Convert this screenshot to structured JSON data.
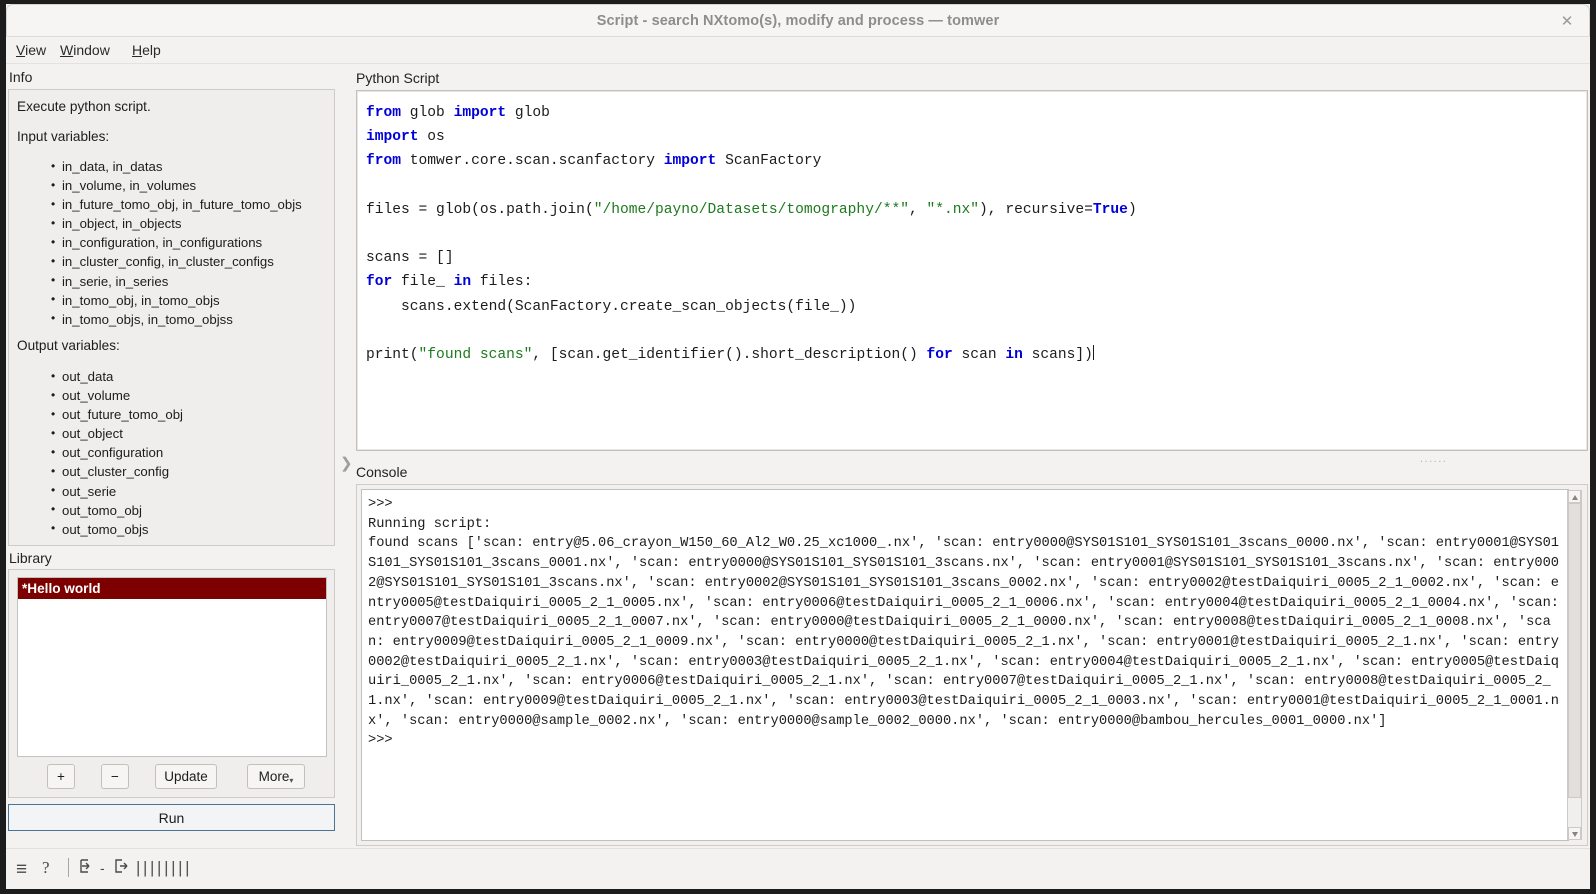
{
  "window": {
    "title": "Script - search NXtomo(s), modify and  process — tomwer",
    "close_label": "✕"
  },
  "menubar": {
    "items": [
      {
        "label": "View",
        "mnemonic": "V"
      },
      {
        "label": "Window",
        "mnemonic": "W"
      },
      {
        "label": "Help",
        "mnemonic": "H"
      }
    ]
  },
  "info": {
    "label": "Info",
    "description": "Execute python script.",
    "input_heading": "Input variables:",
    "input_variables": [
      "in_data, in_datas",
      "in_volume, in_volumes",
      "in_future_tomo_obj, in_future_tomo_objs",
      "in_object, in_objects",
      "in_configuration, in_configurations",
      "in_cluster_config, in_cluster_configs",
      "in_serie, in_series",
      "in_tomo_obj, in_tomo_objs",
      "in_tomo_objs, in_tomo_objss"
    ],
    "output_heading": "Output variables:",
    "output_variables": [
      "out_data",
      "out_volume",
      "out_future_tomo_obj",
      "out_object",
      "out_configuration",
      "out_cluster_config",
      "out_serie",
      "out_tomo_obj",
      "out_tomo_objs"
    ]
  },
  "library": {
    "label": "Library",
    "items": [
      {
        "label": "*Hello world",
        "selected": true
      }
    ],
    "selected_color": "#7c0000",
    "buttons": {
      "add": "+",
      "remove": "−",
      "update": "Update",
      "more": "More",
      "more_caret": "▾"
    },
    "run_label": "Run",
    "run_border_color": "#4b7394"
  },
  "script": {
    "label": "Python Script",
    "lines": [
      [
        {
          "t": "from",
          "c": "kw"
        },
        {
          "t": " glob ",
          "c": ""
        },
        {
          "t": "import",
          "c": "kw"
        },
        {
          "t": " glob",
          "c": ""
        }
      ],
      [
        {
          "t": "import",
          "c": "kw"
        },
        {
          "t": " os",
          "c": ""
        }
      ],
      [
        {
          "t": "from",
          "c": "kw"
        },
        {
          "t": " tomwer.core.scan.scanfactory ",
          "c": ""
        },
        {
          "t": "import",
          "c": "kw"
        },
        {
          "t": " ScanFactory",
          "c": ""
        }
      ],
      [],
      [
        {
          "t": "files = glob(os.path.join(",
          "c": ""
        },
        {
          "t": "\"/home/payno/Datasets/tomography/**\"",
          "c": "str"
        },
        {
          "t": ", ",
          "c": ""
        },
        {
          "t": "\"*.nx\"",
          "c": "str"
        },
        {
          "t": "), recursive=",
          "c": ""
        },
        {
          "t": "True",
          "c": "kw"
        },
        {
          "t": ")",
          "c": ""
        }
      ],
      [],
      [
        {
          "t": "scans = []",
          "c": ""
        }
      ],
      [
        {
          "t": "for",
          "c": "kw"
        },
        {
          "t": " file_ ",
          "c": ""
        },
        {
          "t": "in",
          "c": "kw"
        },
        {
          "t": " files:",
          "c": ""
        }
      ],
      [
        {
          "t": "    scans.extend(ScanFactory.create_scan_objects(file_))",
          "c": ""
        }
      ],
      [],
      [
        {
          "t": "print(",
          "c": ""
        },
        {
          "t": "\"found scans\"",
          "c": "str"
        },
        {
          "t": ", [scan.get_identifier().short_description() ",
          "c": ""
        },
        {
          "t": "for",
          "c": "kw"
        },
        {
          "t": " scan ",
          "c": ""
        },
        {
          "t": "in",
          "c": "kw"
        },
        {
          "t": " scans])",
          "c": ""
        }
      ]
    ],
    "keyword_color": "#0000d8",
    "string_color": "#1d7a1d"
  },
  "console": {
    "label": "Console",
    "text": ">>>\nRunning script:\nfound scans ['scan: entry@5.06_crayon_W150_60_Al2_W0.25_xc1000_.nx', 'scan: entry0000@SYS01S101_SYS01S101_3scans_0000.nx', 'scan: entry0001@SYS01S101_SYS01S101_3scans_0001.nx', 'scan: entry0000@SYS01S101_SYS01S101_3scans.nx', 'scan: entry0001@SYS01S101_SYS01S101_3scans.nx', 'scan: entry0002@SYS01S101_SYS01S101_3scans.nx', 'scan: entry0002@SYS01S101_SYS01S101_3scans_0002.nx', 'scan: entry0002@testDaiquiri_0005_2_1_0002.nx', 'scan: entry0005@testDaiquiri_0005_2_1_0005.nx', 'scan: entry0006@testDaiquiri_0005_2_1_0006.nx', 'scan: entry0004@testDaiquiri_0005_2_1_0004.nx', 'scan: entry0007@testDaiquiri_0005_2_1_0007.nx', 'scan: entry0000@testDaiquiri_0005_2_1_0000.nx', 'scan: entry0008@testDaiquiri_0005_2_1_0008.nx', 'scan: entry0009@testDaiquiri_0005_2_1_0009.nx', 'scan: entry0000@testDaiquiri_0005_2_1.nx', 'scan: entry0001@testDaiquiri_0005_2_1.nx', 'scan: entry0002@testDaiquiri_0005_2_1.nx', 'scan: entry0003@testDaiquiri_0005_2_1.nx', 'scan: entry0004@testDaiquiri_0005_2_1.nx', 'scan: entry0005@testDaiquiri_0005_2_1.nx', 'scan: entry0006@testDaiquiri_0005_2_1.nx', 'scan: entry0007@testDaiquiri_0005_2_1.nx', 'scan: entry0008@testDaiquiri_0005_2_1.nx', 'scan: entry0009@testDaiquiri_0005_2_1.nx', 'scan: entry0003@testDaiquiri_0005_2_1_0003.nx', 'scan: entry0001@testDaiquiri_0005_2_1_0001.nx', 'scan: entry0000@sample_0002.nx', 'scan: entry0000@sample_0002_0000.nx', 'scan: entry0000@bambou_hercules_0001_0000.nx']\n>>>"
  },
  "statusbar": {
    "menu_icon": "≡",
    "help_icon": "?",
    "input_icon": "⇥",
    "dash": "-",
    "output_icon": "⇥",
    "bars": "||||||||"
  }
}
